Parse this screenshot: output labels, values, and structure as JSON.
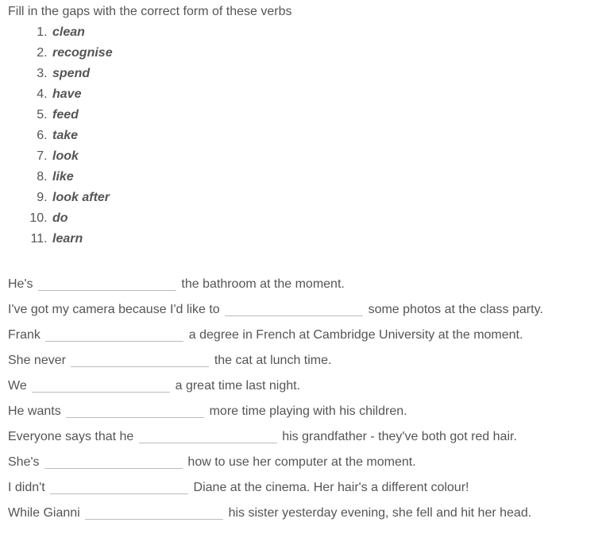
{
  "intro": "Fill in the gaps with the correct form of these verbs",
  "verbs": [
    "clean",
    "recognise",
    "spend",
    "have",
    "feed",
    "take",
    "look",
    "like",
    "look after",
    "do",
    "learn"
  ],
  "sentences": [
    {
      "pre": "He's ",
      "post": " the bathroom at the moment."
    },
    {
      "pre": "I've got my camera because I'd like to ",
      "post": " some photos at the class party."
    },
    {
      "pre": "Frank ",
      "post": " a degree in French at Cambridge University at the moment."
    },
    {
      "pre": "She never ",
      "post": " the cat at lunch time."
    },
    {
      "pre": "We ",
      "post": " a great time last night."
    },
    {
      "pre": "He wants ",
      "post": " more time playing with his children."
    },
    {
      "pre": "Everyone says that he ",
      "post": " his grandfather - they've both got red hair."
    },
    {
      "pre": "She's ",
      "post": " how to use her computer at the moment."
    },
    {
      "pre": "I didn't ",
      "post": " Diane at the cinema. Her hair's a different colour!"
    },
    {
      "pre": "While Gianni ",
      "post": " his sister yesterday evening, she fell and hit her head."
    }
  ]
}
